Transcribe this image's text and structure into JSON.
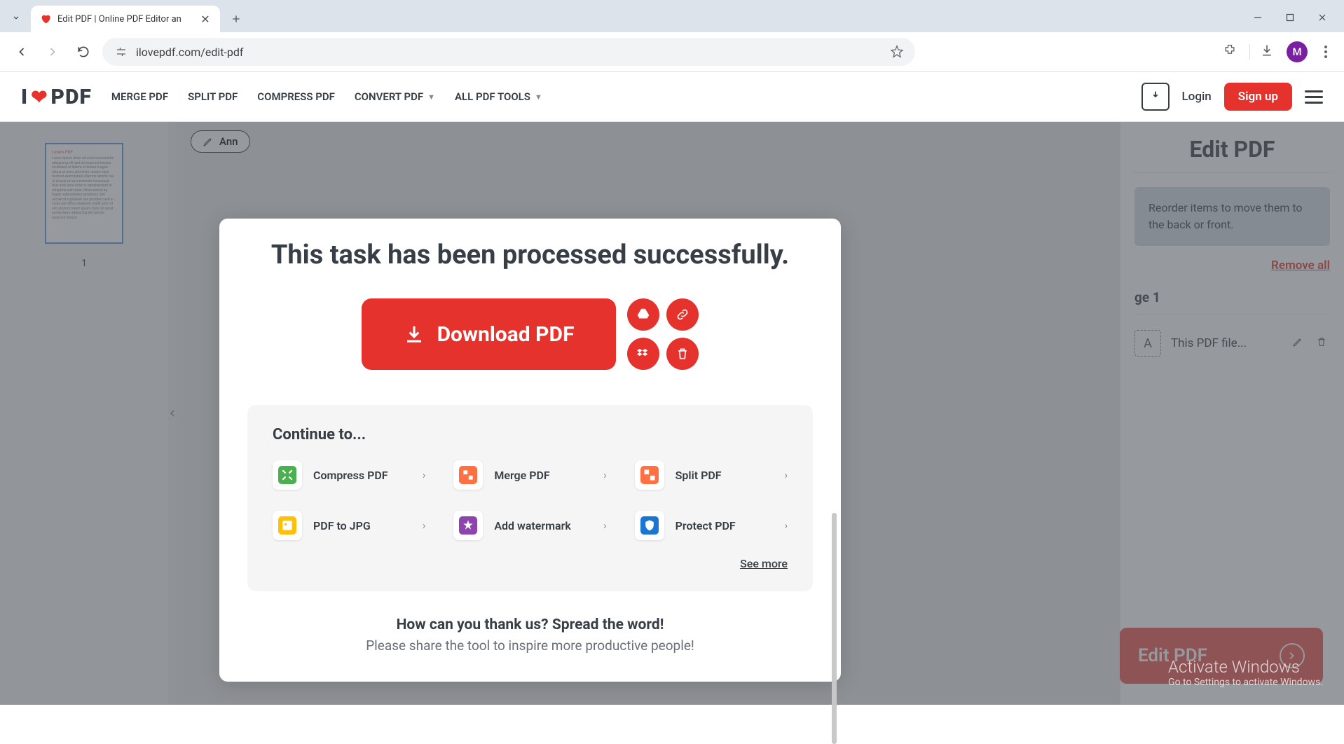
{
  "browser": {
    "tab_title": "Edit PDF | Online PDF Editor an",
    "url": "ilovepdf.com/edit-pdf",
    "avatar_letter": "M"
  },
  "header": {
    "logo_prefix": "I",
    "logo_suffix": "PDF",
    "nav": {
      "merge": "MERGE PDF",
      "split": "SPLIT PDF",
      "compress": "COMPRESS PDF",
      "convert": "CONVERT PDF",
      "all_tools": "ALL PDF TOOLS"
    },
    "login": "Login",
    "signup": "Sign up"
  },
  "thumbnail": {
    "page_number": "1"
  },
  "annotate_label": "Ann",
  "right_panel": {
    "title": "Edit PDF",
    "info": "Reorder items to move them to the back or front.",
    "remove_all": "Remove all",
    "page_label": "ge 1",
    "item_name": "This PDF file...",
    "cta": "Edit PDF"
  },
  "modal": {
    "title": "This task has been processed successfully.",
    "download_label": "Download PDF",
    "continue_title": "Continue to...",
    "tools": [
      {
        "name": "Compress PDF",
        "color": "#4caf50"
      },
      {
        "name": "Merge PDF",
        "color": "#ff7043"
      },
      {
        "name": "Split PDF",
        "color": "#ff7043"
      },
      {
        "name": "PDF to JPG",
        "color": "#ffc107"
      },
      {
        "name": "Add watermark",
        "color": "#8e44ad"
      },
      {
        "name": "Protect PDF",
        "color": "#1976d2"
      }
    ],
    "see_more": "See more",
    "share_title": "How can you thank us? Spread the word!",
    "share_sub": "Please share the tool to inspire more productive people!"
  },
  "watermark": {
    "title": "Activate Windows",
    "sub": "Go to Settings to activate Windows."
  }
}
